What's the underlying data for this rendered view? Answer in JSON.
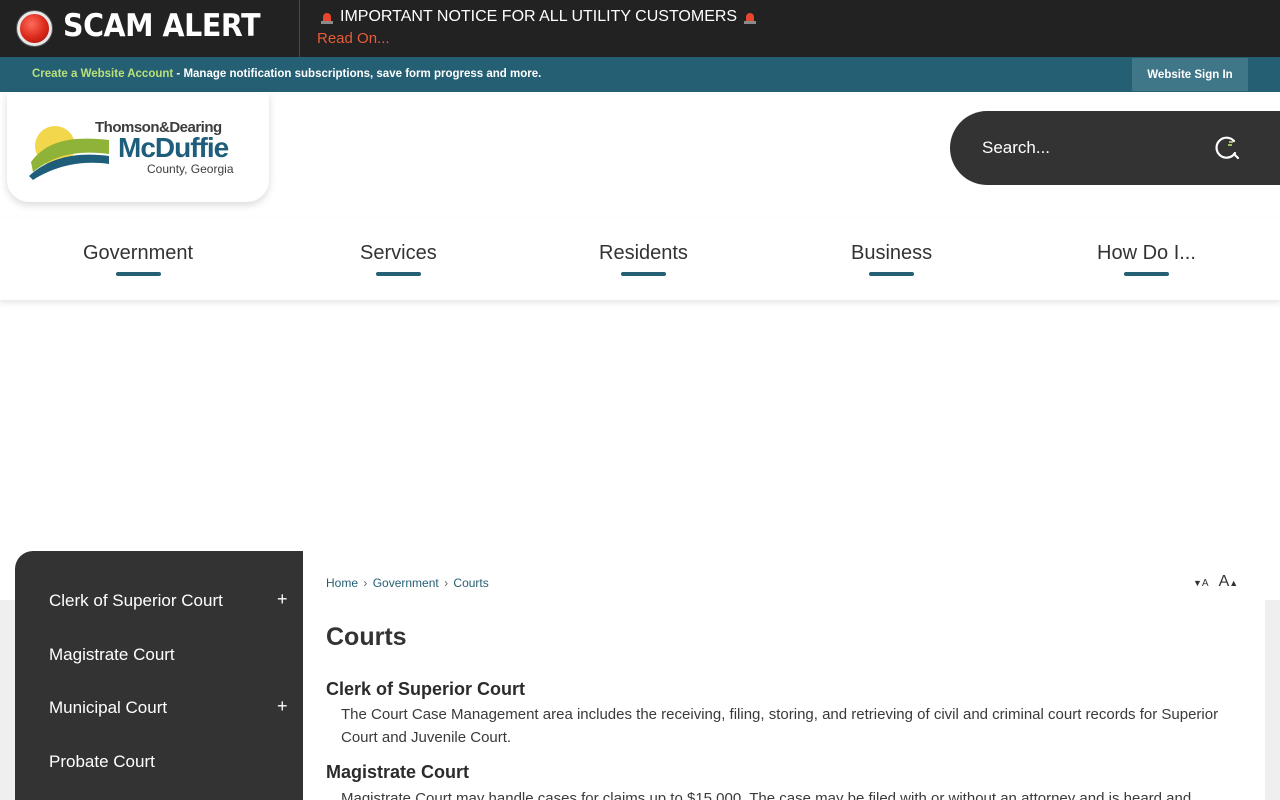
{
  "alert": {
    "title": "SCAM ALERT",
    "notice": "IMPORTANT NOTICE FOR ALL UTILITY CUSTOMERS",
    "read_on": "Read On..."
  },
  "account": {
    "create_link": "Create a Website Account",
    "description": " - Manage notification subscriptions, save form progress and more.",
    "sign_in": "Website Sign In"
  },
  "logo": {
    "line1": "Thomson&Dearing",
    "line2": "McDuffie",
    "line3": "County, Georgia"
  },
  "search": {
    "placeholder": "Search..."
  },
  "nav": {
    "items": [
      "Government",
      "Services",
      "Residents",
      "Business",
      "How Do I..."
    ]
  },
  "sidebar": {
    "items": [
      {
        "label": "Clerk of Superior Court",
        "expandable": "+"
      },
      {
        "label": "Magistrate Court"
      },
      {
        "label": "Municipal Court",
        "expandable": "+"
      },
      {
        "label": "Probate Court"
      }
    ]
  },
  "breadcrumb": {
    "items": [
      "Home",
      "Government",
      "Courts"
    ],
    "separator": "›"
  },
  "font_controls": {
    "decrease": "A",
    "increase": "A"
  },
  "page": {
    "title": "Courts",
    "sections": [
      {
        "heading": "Clerk of Superior Court",
        "body": "The Court Case Management area includes the receiving, filing, storing, and retrieving of civil and criminal court records for Superior Court and Juvenile Court."
      },
      {
        "heading": "Magistrate Court",
        "body": "Magistrate Court may handle cases for claims up to $15,000. The case may be filed with or without an attorney and is heard and"
      }
    ]
  },
  "colors": {
    "alert_bg": "#222222",
    "account_bar": "#255f74",
    "accent_green": "#b9e07a",
    "read_on": "#e85c38",
    "sidebar_bg": "#333333"
  }
}
